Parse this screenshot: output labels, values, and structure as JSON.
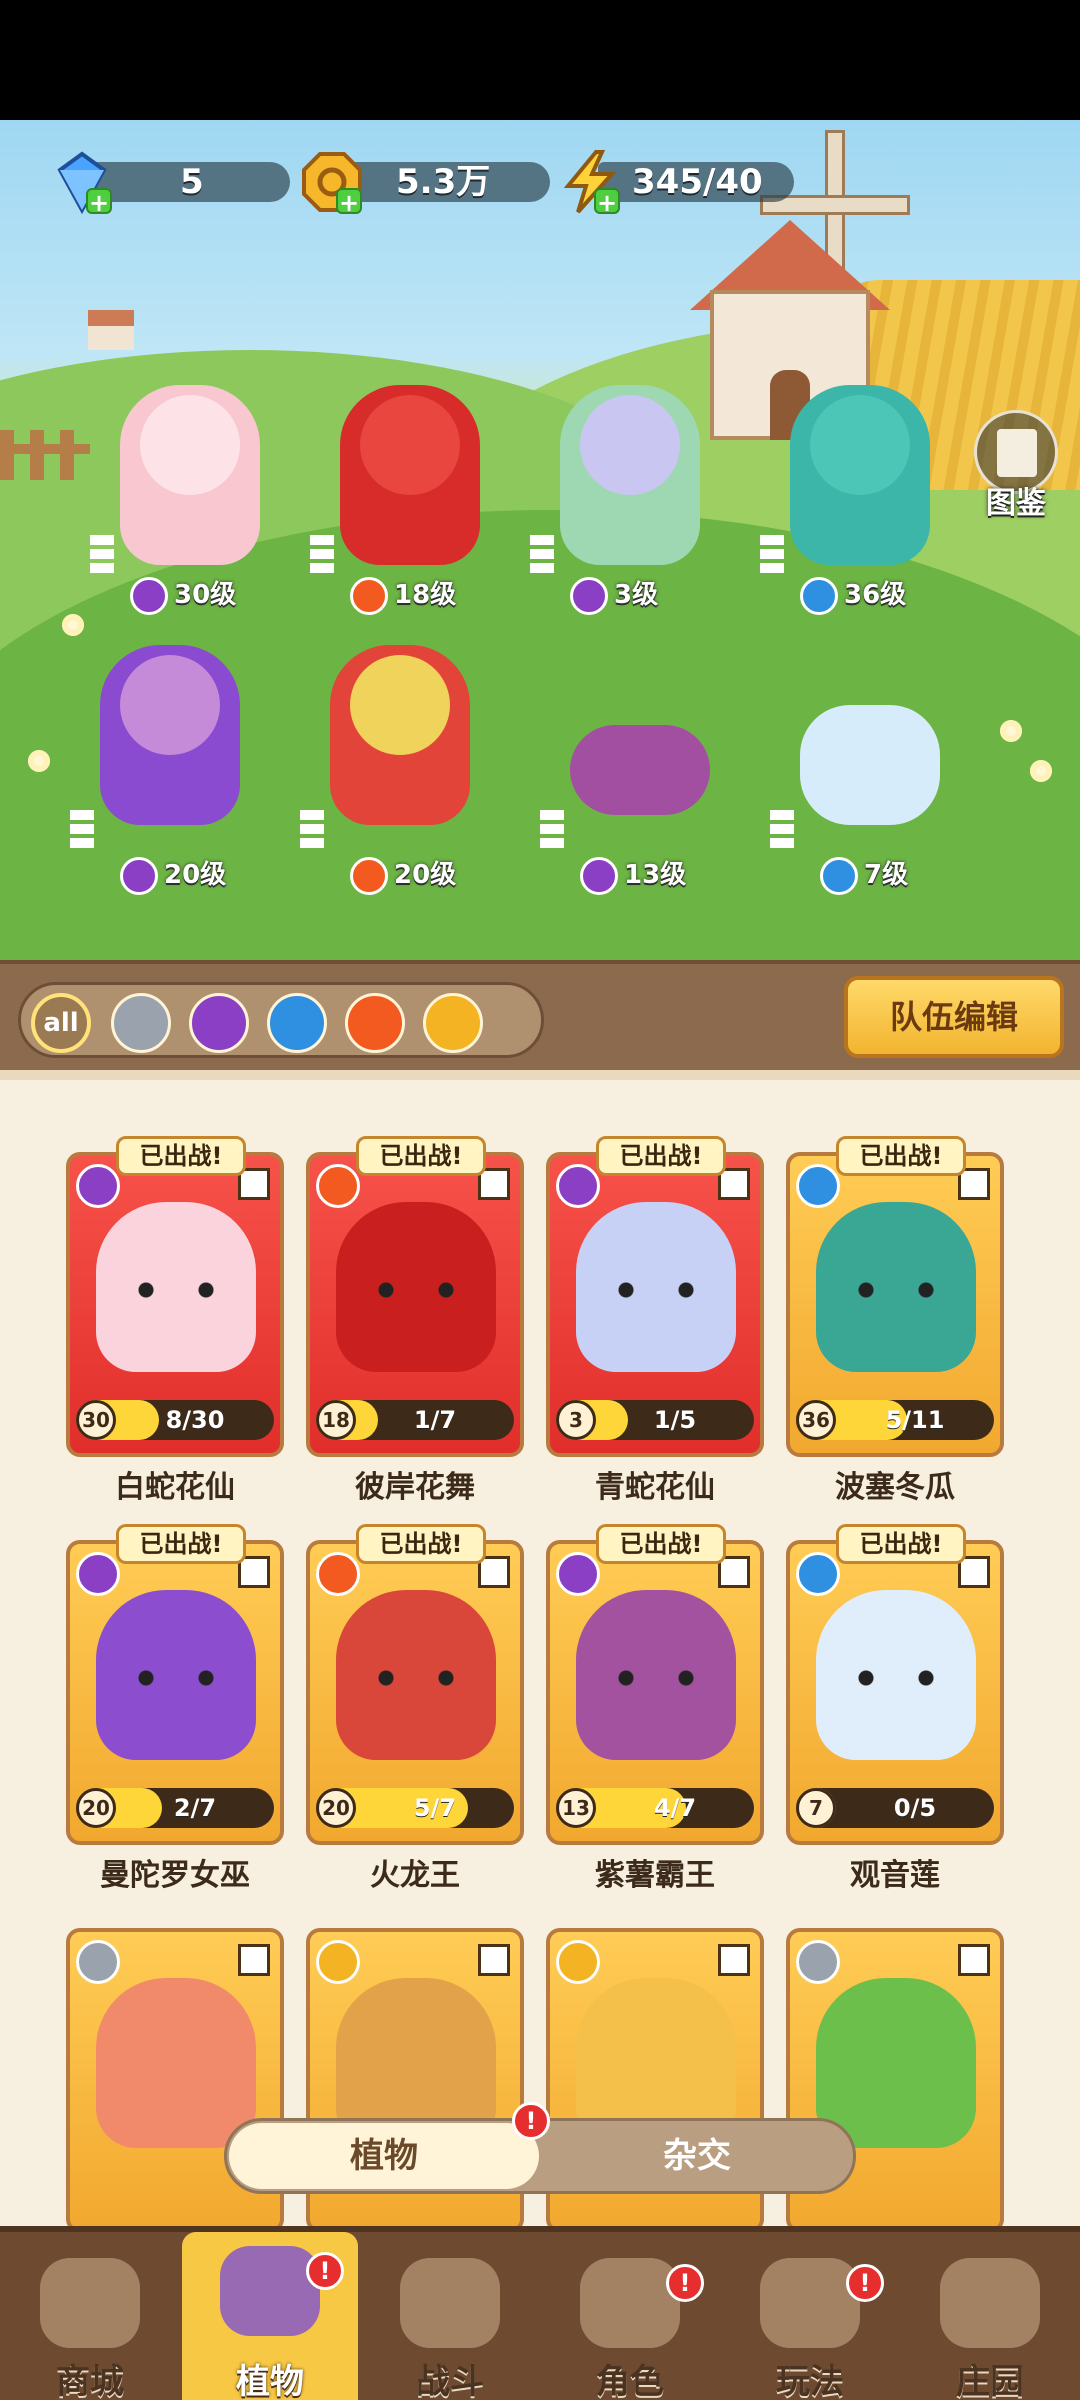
{
  "currencies": [
    {
      "name": "gem",
      "icon": "diamond-icon",
      "value": "5"
    },
    {
      "name": "gold",
      "icon": "gold-coin-icon",
      "value": "5.3万"
    },
    {
      "name": "energy",
      "icon": "lightning-icon",
      "value": "345/40"
    }
  ],
  "codex": {
    "label": "图鉴"
  },
  "lineup": [
    {
      "element": "poison",
      "level": "30级"
    },
    {
      "element": "fire",
      "level": "18级"
    },
    {
      "element": "poison",
      "level": "3级"
    },
    {
      "element": "water",
      "level": "36级"
    },
    {
      "element": "poison",
      "level": "20级"
    },
    {
      "element": "fire",
      "level": "20级"
    },
    {
      "element": "poison",
      "level": "13级"
    },
    {
      "element": "water",
      "level": "7级"
    }
  ],
  "filters": {
    "all_label": "all",
    "tabs": [
      "all",
      "physical",
      "poison",
      "water",
      "fire",
      "lightning"
    ]
  },
  "team_edit_label": "队伍编辑",
  "deployed_label": "已出战!",
  "cards": [
    {
      "name": "白蛇花仙",
      "level": "30",
      "progress": "8/30",
      "fill": 0.27,
      "element": "poison",
      "frame": "red"
    },
    {
      "name": "彼岸花舞",
      "level": "18",
      "progress": "1/7",
      "fill": 0.14,
      "element": "fire",
      "frame": "red"
    },
    {
      "name": "青蛇花仙",
      "level": "3",
      "progress": "1/5",
      "fill": 0.2,
      "element": "poison",
      "frame": "red"
    },
    {
      "name": "波塞冬瓜",
      "level": "36",
      "progress": "5/11",
      "fill": 0.45,
      "element": "water",
      "frame": "gold"
    },
    {
      "name": "曼陀罗女巫",
      "level": "20",
      "progress": "2/7",
      "fill": 0.29,
      "element": "poison",
      "frame": "gold"
    },
    {
      "name": "火龙王",
      "level": "20",
      "progress": "5/7",
      "fill": 0.71,
      "element": "fire",
      "frame": "gold"
    },
    {
      "name": "紫薯霸王",
      "level": "13",
      "progress": "4/7",
      "fill": 0.57,
      "element": "poison",
      "frame": "gold"
    },
    {
      "name": "观音莲",
      "level": "7",
      "progress": "0/5",
      "fill": 0.0,
      "element": "water",
      "frame": "gold"
    }
  ],
  "partial_cards": [
    {
      "element": "physical"
    },
    {
      "element": "lightning"
    },
    {
      "element": "lightning"
    },
    {
      "element": "physical"
    }
  ],
  "toggle": {
    "on_label": "植物",
    "off_label": "杂交",
    "on_alert": "!"
  },
  "nav": [
    {
      "label": "商城",
      "alert": ""
    },
    {
      "label": "植物",
      "alert": "!"
    },
    {
      "label": "战斗",
      "alert": ""
    },
    {
      "label": "角色",
      "alert": "!"
    },
    {
      "label": "玩法",
      "alert": "!"
    },
    {
      "label": "庄园",
      "alert": ""
    }
  ],
  "colors": {
    "fire": "#f25a1f",
    "water": "#2f8fe0",
    "poison": "#8a3fc4",
    "physical": "#9aa3ad",
    "lightning": "#f3b323"
  }
}
